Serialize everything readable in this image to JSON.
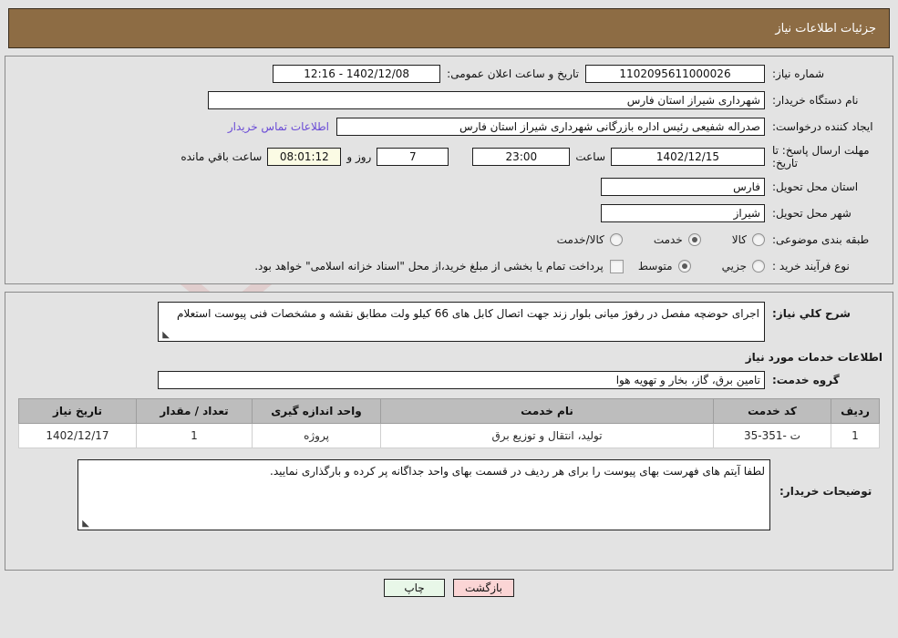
{
  "header": {
    "title": "جزئیات اطلاعات نیاز"
  },
  "watermark": {
    "text": "AriaTender.net"
  },
  "form": {
    "need_number": {
      "label": "شماره نیاز:",
      "value": "1102095611000026"
    },
    "public_announce": {
      "label": "تاریخ و ساعت اعلان عمومی:",
      "value": "1402/12/08 - 12:16"
    },
    "buyer_org": {
      "label": "نام دستگاه خریدار:",
      "value": "شهرداری شیراز استان فارس"
    },
    "request_creator": {
      "label": "ایجاد کننده درخواست:",
      "value": "صدراله شفیعی رئیس اداره بازرگانی  شهرداری شیراز استان فارس"
    },
    "contact_link": "اطلاعات تماس خریدار",
    "deadline": {
      "label": "مهلت ارسال پاسخ: تا تاریخ:",
      "date": "1402/12/15",
      "time_label": "ساعت",
      "time": "23:00",
      "days": "7",
      "days_label": "روز و",
      "remaining": "08:01:12",
      "remaining_label": "ساعت باقي مانده"
    },
    "province": {
      "label": "استان محل تحویل:",
      "value": "فارس"
    },
    "city": {
      "label": "شهر محل تحویل:",
      "value": "شیراز"
    },
    "category": {
      "label": "طبقه بندی موضوعی:",
      "options": [
        {
          "label": "کالا",
          "selected": false
        },
        {
          "label": "خدمت",
          "selected": true
        },
        {
          "label": "کالا/خدمت",
          "selected": false
        }
      ]
    },
    "process_type": {
      "label": "نوع فرآیند خرید :",
      "options": [
        {
          "label": "جزیي",
          "selected": false
        },
        {
          "label": "متوسط",
          "selected": true
        }
      ],
      "treasury_note": "پرداخت تمام یا بخشی از مبلغ خرید،از محل \"اسناد خزانه اسلامی\" خواهد بود.",
      "treasury_checked": false
    }
  },
  "description": {
    "label": "شرح کلي نیاز:",
    "value": "اجرای حوضچه مفصل در رفوژ میانی بلوار زند جهت اتصال کابل های 66 کیلو ولت مطابق نقشه و مشخصات فنی پیوست استعلام"
  },
  "services_section": {
    "heading": "اطلاعات خدمات مورد نیاز",
    "group": {
      "label": "گروه خدمت:",
      "value": "تامین برق، گاز، بخار و تهویه هوا"
    },
    "table": {
      "columns": [
        "ردیف",
        "کد خدمت",
        "نام خدمت",
        "واحد اندازه گیری",
        "تعداد / مقدار",
        "تاریخ نیاز"
      ],
      "rows": [
        {
          "radif": "1",
          "code": "ت -351-35",
          "name": "تولید، انتقال و توزیع برق",
          "unit": "پروژه",
          "qty": "1",
          "date": "1402/12/17"
        }
      ]
    }
  },
  "buyer_notes": {
    "label": "توضیحات خریدار:",
    "value": "لطفا آیتم های فهرست بهای پیوست را برای هر ردیف در قسمت بهای واحد جداگانه پر کرده و بارگذاری نمایید."
  },
  "footer": {
    "back_label": "بازگشت",
    "print_label": "چاپ"
  },
  "colors": {
    "header_bg": "#8d6c44",
    "back_button": "#fbd5d5",
    "print_button": "#e8f7e8",
    "link": "#6a4bd6",
    "highlight_field": "#fbfbe4",
    "table_header": "#bdbdbd"
  }
}
